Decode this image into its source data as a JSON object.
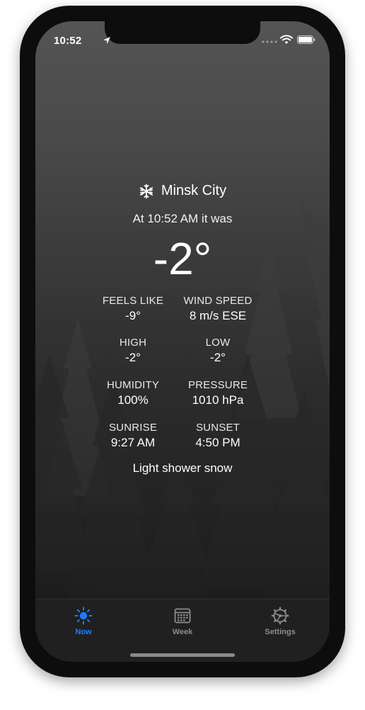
{
  "status_bar": {
    "time": "10:52",
    "icons": [
      "location-arrow-icon",
      "cellular-signal-icon",
      "wifi-icon",
      "battery-icon"
    ]
  },
  "weather": {
    "condition_icon": "snowflake-icon",
    "city": "Minsk City",
    "time_line": "At 10:52 AM it was",
    "temperature": "-2°",
    "condition": "Light shower snow",
    "details": [
      {
        "label": "FEELS LIKE",
        "value": "-9°"
      },
      {
        "label": "WIND SPEED",
        "value": "8 m/s ESE"
      },
      {
        "label": "HIGH",
        "value": "-2°"
      },
      {
        "label": "LOW",
        "value": "-2°"
      },
      {
        "label": "HUMIDITY",
        "value": "100%"
      },
      {
        "label": "PRESSURE",
        "value": "1010 hPa"
      },
      {
        "label": "SUNRISE",
        "value": "9:27 AM"
      },
      {
        "label": "SUNSET",
        "value": "4:50 PM"
      }
    ]
  },
  "tab_bar": {
    "tabs": [
      {
        "label": "Now",
        "icon": "sun-icon",
        "selected": true
      },
      {
        "label": "Week",
        "icon": "calendar-icon",
        "selected": false
      },
      {
        "label": "Settings",
        "icon": "gear-icon",
        "selected": false
      }
    ]
  },
  "colors": {
    "accent": "#1f7cff",
    "tab_inactive": "#8c8c8c",
    "tab_bar_bg": "#202020"
  }
}
